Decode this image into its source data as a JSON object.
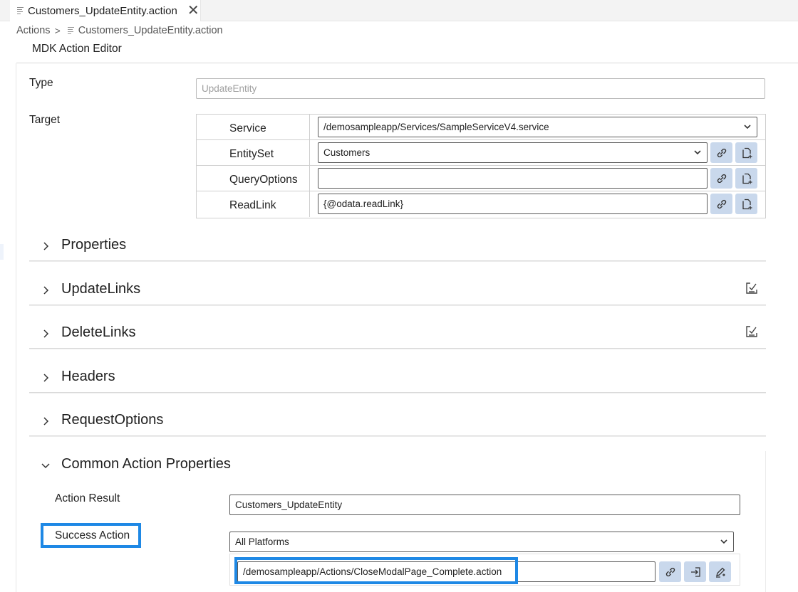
{
  "tab": {
    "title": "Customers_UpdateEntity.action",
    "close": "✕"
  },
  "breadcrumb": {
    "root": "Actions",
    "separator": ">",
    "file": "Customers_UpdateEntity.action"
  },
  "editor": {
    "title": "MDK Action Editor"
  },
  "fields": {
    "type_label": "Type",
    "type_value": "UpdateEntity",
    "target_label": "Target"
  },
  "target": {
    "rows": [
      {
        "label": "Service",
        "value": "/demosampleapp/Services/SampleServiceV4.service"
      },
      {
        "label": "EntitySet",
        "value": "Customers"
      },
      {
        "label": "QueryOptions",
        "value": ""
      },
      {
        "label": "ReadLink",
        "value": "{@odata.readLink}"
      }
    ]
  },
  "sections": {
    "properties": "Properties",
    "update_links": "UpdateLinks",
    "delete_links": "DeleteLinks",
    "headers": "Headers",
    "request_options": "RequestOptions",
    "common": "Common Action Properties"
  },
  "common": {
    "action_result_label": "Action Result",
    "action_result_value": "Customers_UpdateEntity",
    "success_action_label": "Success Action",
    "platform_value": "All Platforms",
    "success_action_value": "/demosampleapp/Actions/CloseModalPage_Complete.action"
  },
  "colors": {
    "accent_highlight": "#1e88e5",
    "icon_button_bg": "#c9d8ec"
  },
  "icons": [
    "file-icon",
    "close-icon",
    "chevron-right-icon",
    "chevron-down-icon",
    "link-icon",
    "new-file-icon",
    "checklist-icon",
    "enter-icon",
    "pen-icon"
  ]
}
